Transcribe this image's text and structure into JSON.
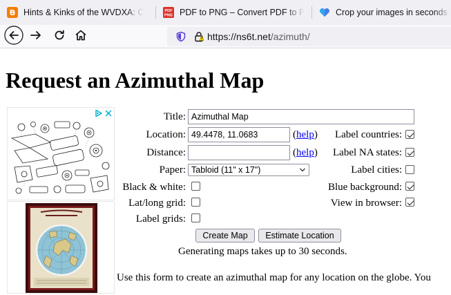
{
  "browser": {
    "tabs": [
      {
        "label": "Hints & Kinks of the WVDXA: C",
        "icon": "blogger-icon"
      },
      {
        "label": "PDF to PNG – Convert PDF to P",
        "icon": "pdf-png-icon",
        "icon_text": "PDF PNG"
      },
      {
        "label": "Crop your images in seconds fo",
        "icon": "heart-icon"
      }
    ],
    "url_host": "https://ns6t.net",
    "url_path": "/azimuth/"
  },
  "page": {
    "title": "Request an Azimuthal Map"
  },
  "form": {
    "title_label": "Title:",
    "title_value": "Azimuthal Map",
    "location_label": "Location:",
    "location_value": "49.4478, 11.0683",
    "distance_label": "Distance:",
    "distance_value": "",
    "help_open": "(",
    "help_link": "help",
    "help_close": ")",
    "paper_label": "Paper:",
    "paper_value": "Tabloid (11\" x 17\")",
    "bw_label": "Black & white:",
    "grid_label": "Lat/long grid:",
    "label_grids_label": "Label grids:",
    "label_countries_label": "Label countries:",
    "label_na_states_label": "Label NA states:",
    "label_cities_label": "Label cities:",
    "blue_bg_label": "Blue background:",
    "view_browser_label": "View in browser:",
    "checkboxes": {
      "black_white": false,
      "latlong_grid": false,
      "label_grids": false,
      "label_countries": true,
      "label_na_states": true,
      "label_cities": false,
      "blue_background": true,
      "view_in_browser": true
    },
    "create_button": "Create Map",
    "estimate_button": "Estimate Location",
    "notice": "Generating maps takes up to 30 seconds.",
    "description": "Use this form to create an azimuthal map for any location on the globe. You"
  },
  "colors": {
    "link": "#0000ee",
    "tabbar_bg": "#f0f0f4",
    "navbar_bg": "#f9f9fb",
    "blogger_orange": "#f57d00",
    "adchoices_blue": "#00aecd"
  }
}
